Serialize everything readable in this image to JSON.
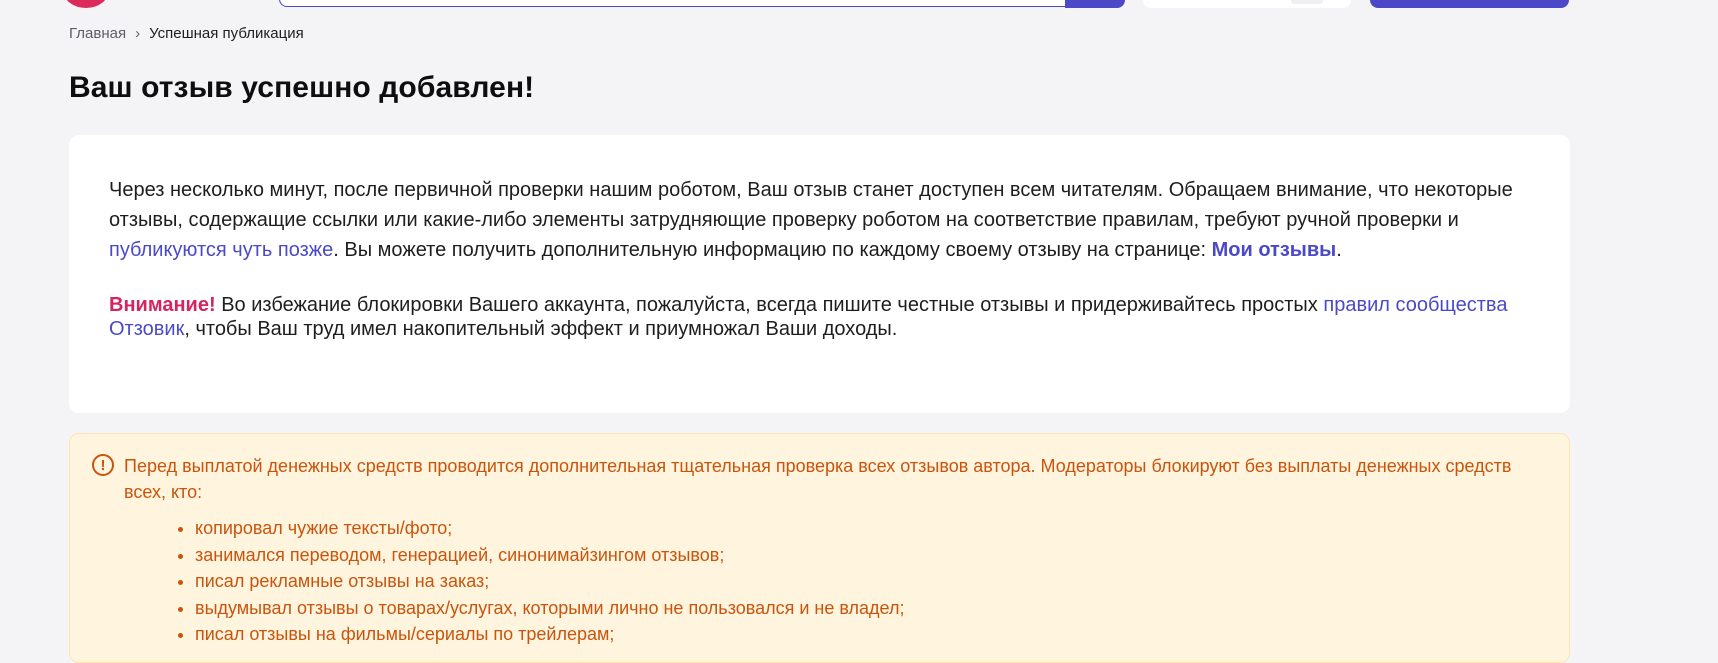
{
  "breadcrumb": {
    "home": "Главная",
    "separator": "›",
    "current": "Успешная публикация"
  },
  "page_title": "Ваш отзыв успешно добавлен!",
  "info": {
    "p1_part1": "Через несколько минут, после первичной проверки нашим роботом, Ваш отзыв станет доступен всем читателям. Обращаем внимание, что некоторые отзывы, содержащие ссылки или какие-либо элементы затрудняющие проверку роботом на соответствие правилам, требуют ручной проверки и ",
    "p1_link": "публикуются чуть позже",
    "p1_part2": ". Вы можете получить дополнительную информацию по каждому своему отзыву на странице: ",
    "p1_my_reviews": "Мои отзывы",
    "p1_end": ".",
    "attention_label": "Внимание!",
    "p2_part1": " Во избежание блокировки Вашего аккаунта, пожалуйста, всегда пишите честные отзывы и придерживайтесь простых ",
    "p2_link": "правил сообщества Отзовик",
    "p2_part2": ", чтобы Ваш труд имел накопительный эффект и приумножал Ваши доходы."
  },
  "notice": {
    "icon": "exclamation-circle-icon",
    "text": "Перед выплатой денежных средств проводится дополнительная тщательная проверка всех отзывов автора. Модераторы блокируют без выплаты денежных средств всех, кто:",
    "items": [
      "копировал чужие тексты/фото;",
      "занимался переводом, генерацией, синонимайзингом отзывов;",
      "писал рекламные отзывы на заказ;",
      "выдумывал отзывы о товарах/услугах, которыми лично не пользовался и не владел;",
      "писал отзывы на фильмы/сериалы по трейлерам;"
    ]
  },
  "colors": {
    "accent": "#4b49c7",
    "attention": "#d5245e",
    "notice_text": "#c9540c",
    "notice_bg": "#fff5df"
  }
}
